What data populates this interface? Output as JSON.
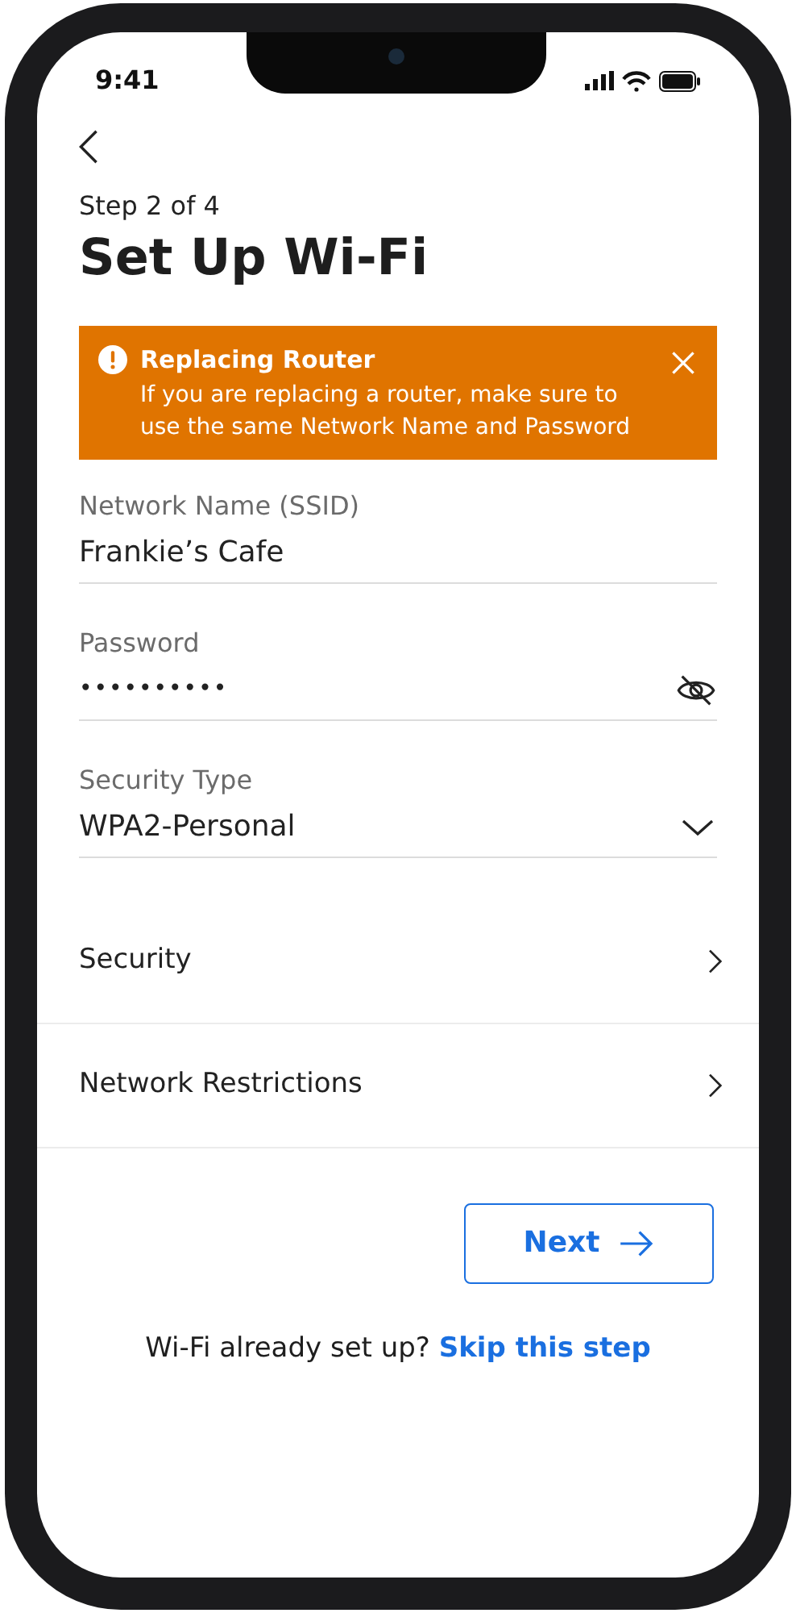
{
  "status_bar": {
    "time": "9:41"
  },
  "step": "Step 2 of 4",
  "title": "Set Up Wi-Fi",
  "banner": {
    "title": "Replacing Router",
    "message": "If you are replacing a router, make sure to use the same Network Name and Password"
  },
  "fields": [
    {
      "kind": "text",
      "label": "Network Name (SSID)",
      "value": "Frankie’s Cafe"
    },
    {
      "kind": "password",
      "label": "Password",
      "value": "••••••••••"
    },
    {
      "kind": "select",
      "label": "Security Type",
      "value": "WPA2-Personal"
    }
  ],
  "rows": [
    {
      "label": "Security"
    },
    {
      "label": "Network Restrictions"
    }
  ],
  "next_button": "Next",
  "footer": {
    "prompt": "Wi-Fi already set up?",
    "link": "Skip this step"
  }
}
